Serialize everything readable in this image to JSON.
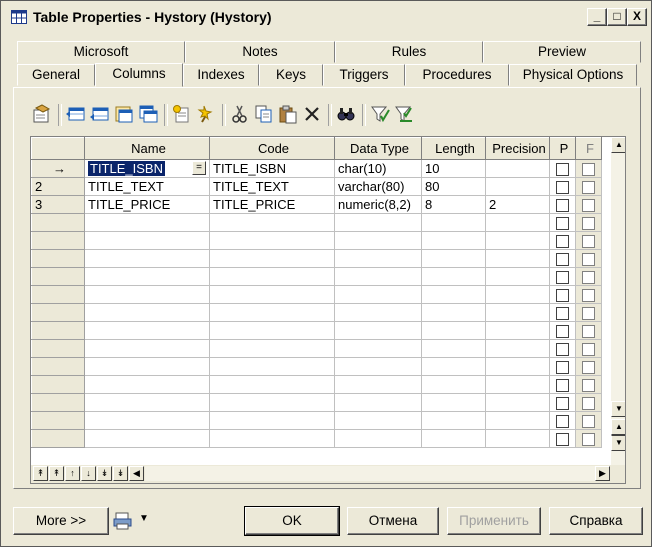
{
  "window": {
    "title": "Table Properties - Hystory (Hystory)",
    "controls": [
      "_",
      "□",
      "X"
    ]
  },
  "tabs_back": [
    "Microsoft",
    "Notes",
    "Rules",
    "Preview"
  ],
  "tabs_front": [
    "General",
    "Columns",
    "Indexes",
    "Keys",
    "Triggers",
    "Procedures",
    "Physical Options"
  ],
  "active_tab": "Columns",
  "grid": {
    "headers": [
      "Name",
      "Code",
      "Data Type",
      "Length",
      "Precision",
      "P",
      "F"
    ],
    "rows": [
      {
        "rowhead": "→",
        "name": "TITLE_ISBN",
        "code": "TITLE_ISBN",
        "type": "char(10)",
        "length": "10",
        "precision": ""
      },
      {
        "rowhead": "2",
        "name": "TITLE_TEXT",
        "code": "TITLE_TEXT",
        "type": "varchar(80)",
        "length": "80",
        "precision": ""
      },
      {
        "rowhead": "3",
        "name": "TITLE_PRICE",
        "code": "TITLE_PRICE",
        "type": "numeric(8,2)",
        "length": "8",
        "precision": "2"
      }
    ],
    "empty_rows": 13,
    "edit_button": "="
  },
  "footer": {
    "more": "More >>",
    "ok": "OK",
    "cancel": "Отмена",
    "apply": "Применить",
    "help": "Справка"
  },
  "colors": {
    "selection": "#0a246a",
    "face": "#ece9d8"
  }
}
